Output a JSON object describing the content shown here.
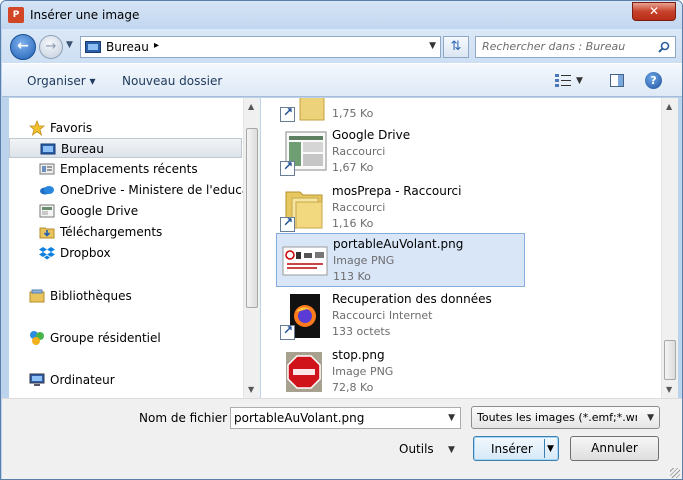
{
  "window": {
    "title": "Insérer une image",
    "close_glyph": "✕"
  },
  "address": {
    "location": "Bureau",
    "separator": "▸"
  },
  "search": {
    "placeholder": "Rechercher dans : Bureau"
  },
  "toolbar": {
    "organise_label": "Organiser ▾",
    "new_folder_label": "Nouveau dossier"
  },
  "nav": {
    "favorites": "Favoris",
    "favorites_items": [
      {
        "label": "Bureau",
        "icon": "desktop-icon",
        "selected": true
      },
      {
        "label": "Emplacements récents",
        "icon": "recent-places-icon"
      },
      {
        "label": "OneDrive - Ministere de l'education",
        "icon": "onedrive-icon"
      },
      {
        "label": "Google Drive",
        "icon": "google-drive-icon"
      },
      {
        "label": "Téléchargements",
        "icon": "downloads-icon"
      },
      {
        "label": "Dropbox",
        "icon": "dropbox-icon"
      }
    ],
    "libraries": "Bibliothèques",
    "homegroup": "Groupe résidentiel",
    "computer": "Ordinateur"
  },
  "files": [
    {
      "name": "",
      "type": "",
      "size": "1,75 Ko",
      "icon": "folder-shortcut-icon",
      "shortcut": true
    },
    {
      "name": "Google Drive",
      "type": "Raccourci",
      "size": "1,67 Ko",
      "icon": "google-drive-shortcut-icon",
      "shortcut": true
    },
    {
      "name": "mosPrepa - Raccourci",
      "type": "Raccourci",
      "size": "1,16 Ko",
      "icon": "folder-shortcut-icon",
      "shortcut": true
    },
    {
      "name": "portableAuVolant.png",
      "type": "Image PNG",
      "size": "113 Ko",
      "icon": "png-image-thumbnail",
      "selected": true
    },
    {
      "name": "Recuperation des données",
      "type": "Raccourci Internet",
      "size": "133 octets",
      "icon": "firefox-internet-shortcut-icon",
      "shortcut": true
    },
    {
      "name": "stop.png",
      "type": "Image PNG",
      "size": "72,8 Ko",
      "icon": "stop-sign-image-thumbnail"
    }
  ],
  "bottom": {
    "filename_label": "Nom de fichier :",
    "filename_value": "portableAuVolant.png",
    "filter_value": "Toutes les images (*.emf;*.wmf",
    "tools_label": "Outils",
    "insert_label": "Insérer",
    "cancel_label": "Annuler"
  },
  "colors": {
    "accent": "#2c5fa8",
    "selection": "#d8e6f8",
    "close_button": "#c7412b"
  }
}
